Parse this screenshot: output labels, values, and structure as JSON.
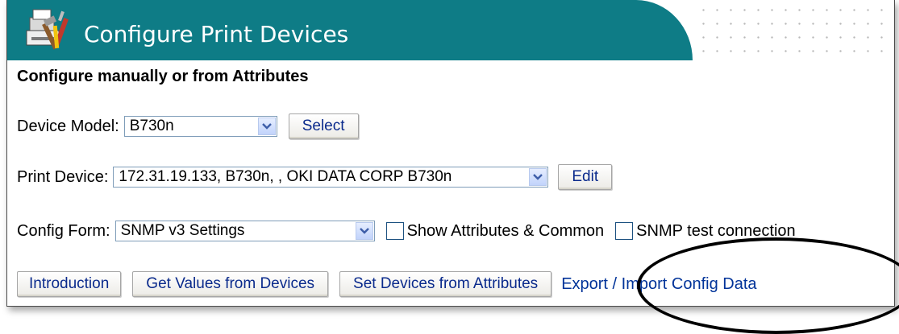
{
  "header": {
    "title": "Configure Print Devices",
    "icon": "printer-tools-icon",
    "bar_color": "#0e7c86"
  },
  "subtitle": "Configure manually or from Attributes",
  "device_model": {
    "label": "Device Model:",
    "value": "B730n",
    "button": "Select"
  },
  "print_device": {
    "label": "Print Device:",
    "value": "172.31.19.133, B730n, , OKI DATA CORP B730n",
    "button": "Edit"
  },
  "config_form": {
    "label": "Config Form:",
    "value": "SNMP v3 Settings",
    "checkbox_show_attributes": "Show Attributes & Common",
    "checkbox_snmp_test": "SNMP test connection"
  },
  "actions": {
    "introduction": "Introduction",
    "get_values": "Get Values from Devices",
    "set_devices": "Set Devices from Attributes",
    "export_import": "Export / Import Config Data"
  },
  "annotation": {
    "highlight_color": "#000000",
    "highlighted": "Export / Import Config Data"
  }
}
